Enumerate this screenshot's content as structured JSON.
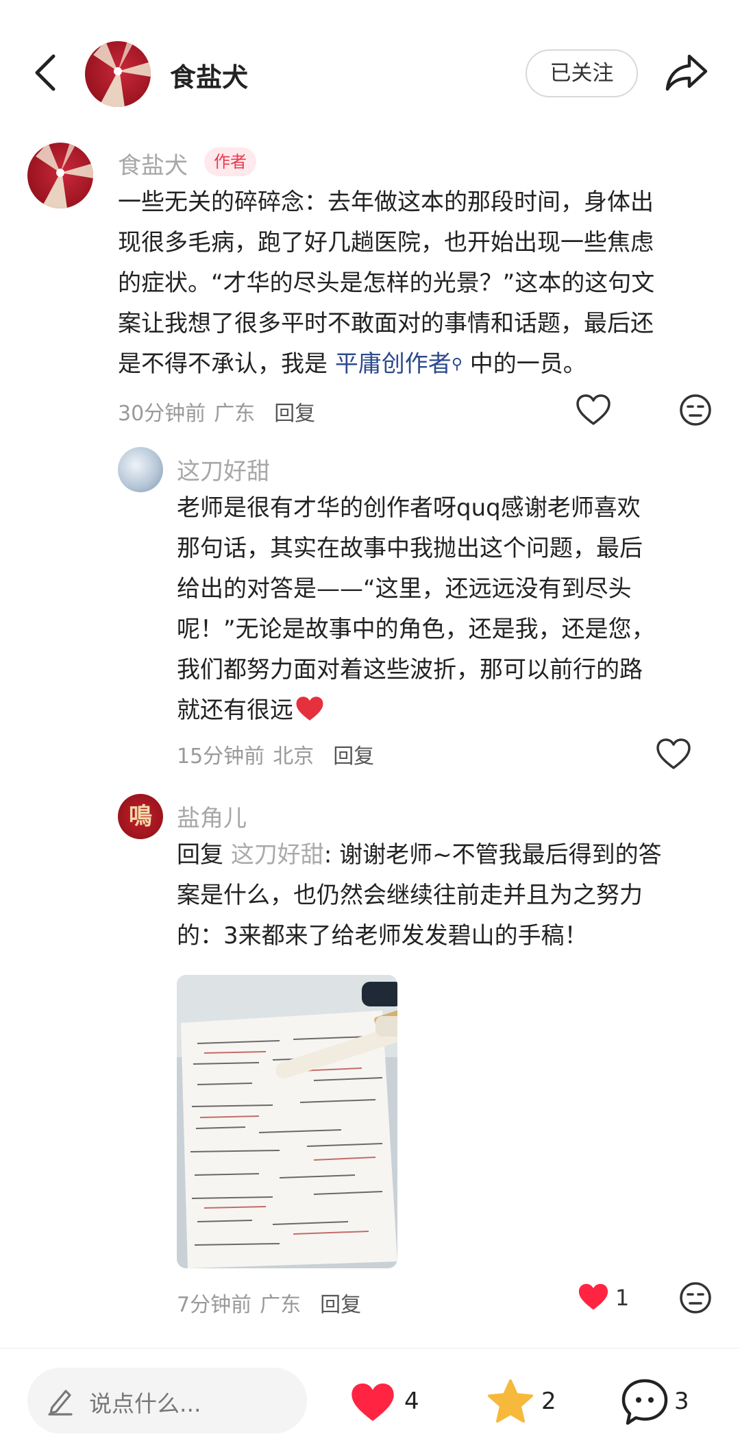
{
  "header": {
    "name": "食盐犬",
    "follow_label": "已关注"
  },
  "post_comment": {
    "username": "食盐犬",
    "badge": "作者",
    "lines": [
      "一些无关的碎碎念：去年做这本的那段时间，身体出",
      "现很多毛病，跑了好几趟医院，也开始出现一些焦虑",
      "的症状。“才华的尽头是怎样的光景？”这本的这句文",
      "案让我想了很多平时不敢面对的事情和话题，最后还"
    ],
    "last_line_prefix": "是不得不承认，我是 ",
    "mention": "平庸创作者",
    "last_line_suffix": " 中的一员。",
    "time": "30分钟前",
    "location": "广东",
    "reply_label": "回复"
  },
  "reply_1": {
    "username": "这刀好甜",
    "lines": [
      "老师是很有才华的创作者呀quq感谢老师喜欢",
      "那句话，其实在故事中我抛出这个问题，最后",
      "给出的对答是——“这里，还远远没有到尽头",
      "呢！”无论是故事中的角色，还是我，还是您，",
      "我们都努力面对着这些波折，那可以前行的路"
    ],
    "last_line": "就还有很远",
    "time": "15分钟前",
    "location": "北京",
    "reply_label": "回复"
  },
  "reply_2": {
    "username": "盐角儿",
    "avatar_char": "鳴",
    "reply_prefix": "回复 ",
    "reply_to": "这刀好甜",
    "first_line_rest": ": 谢谢老师~不管我最后得到的答",
    "lines": [
      "案是什么，也仍然会继续往前走并且为之努力",
      "的：3来都来了给老师发发碧山的手稿！"
    ],
    "time": "7分钟前",
    "location": "广东",
    "reply_label": "回复",
    "like_count": "1"
  },
  "bottom_bar": {
    "input_placeholder": "说点什么...",
    "like_count": "4",
    "star_count": "2",
    "comment_count": "3"
  },
  "colors": {
    "accent_red": "#ff2442",
    "star_yellow": "#f6b93b",
    "mention_blue": "#2c4a8c"
  }
}
